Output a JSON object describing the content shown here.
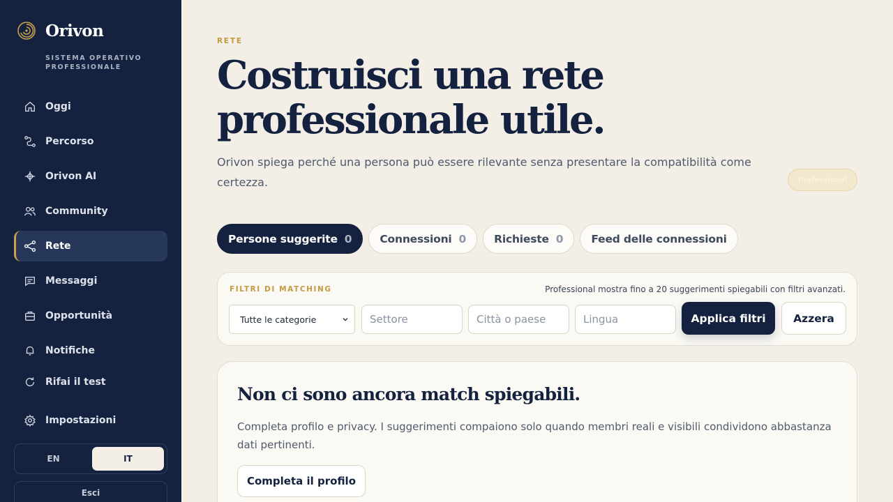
{
  "brand": {
    "name": "Orivon",
    "tagline": "SISTEMA OPERATIVO PROFESSIONALE"
  },
  "nav": [
    {
      "label": "Oggi",
      "icon": "home-icon"
    },
    {
      "label": "Percorso",
      "icon": "route-icon"
    },
    {
      "label": "Orivon AI",
      "icon": "sparkle-icon"
    },
    {
      "label": "Community",
      "icon": "users-icon"
    },
    {
      "label": "Rete",
      "icon": "share-network-icon",
      "active": true
    },
    {
      "label": "Messaggi",
      "icon": "message-icon"
    },
    {
      "label": "Opportunità",
      "icon": "briefcase-icon"
    },
    {
      "label": "Notifiche",
      "icon": "bell-icon"
    },
    {
      "label": "Rifai il test",
      "icon": "refresh-icon"
    },
    {
      "label": "Impostazioni",
      "icon": "gear-icon"
    }
  ],
  "language": {
    "options": [
      "EN",
      "IT"
    ],
    "selected": "IT"
  },
  "logout_label": "Esci",
  "page": {
    "eyebrow": "RETE",
    "title": "Costruisci una rete professionale utile.",
    "lead": "Orivon spiega perché una persona può essere rilevante senza presentare la compatibilità come certezza.",
    "plan_badge": "Professional"
  },
  "tabs": [
    {
      "label": "Persone suggerite",
      "count": "0",
      "active": true
    },
    {
      "label": "Connessioni",
      "count": "0"
    },
    {
      "label": "Richieste",
      "count": "0"
    },
    {
      "label": "Feed delle connessioni",
      "count": ""
    }
  ],
  "filters": {
    "label": "FILTRI DI MATCHING",
    "note": "Professional mostra fino a 20 suggerimenti spiegabili con filtri avanzati.",
    "category_selected": "Tutte le categorie",
    "sector_placeholder": "Settore",
    "city_placeholder": "Città o paese",
    "language_placeholder": "Lingua",
    "apply_label": "Applica filtri",
    "reset_label": "Azzera"
  },
  "empty_state": {
    "title": "Non ci sono ancora match spiegabili.",
    "text": "Completa profilo e privacy. I suggerimenti compaiono solo quando membri reali e visibili condividono abbastanza dati pertinenti.",
    "button_label": "Completa il profilo"
  },
  "colors": {
    "navy": "#14223f",
    "gold": "#c39a3f",
    "background": "#f3efe7"
  }
}
